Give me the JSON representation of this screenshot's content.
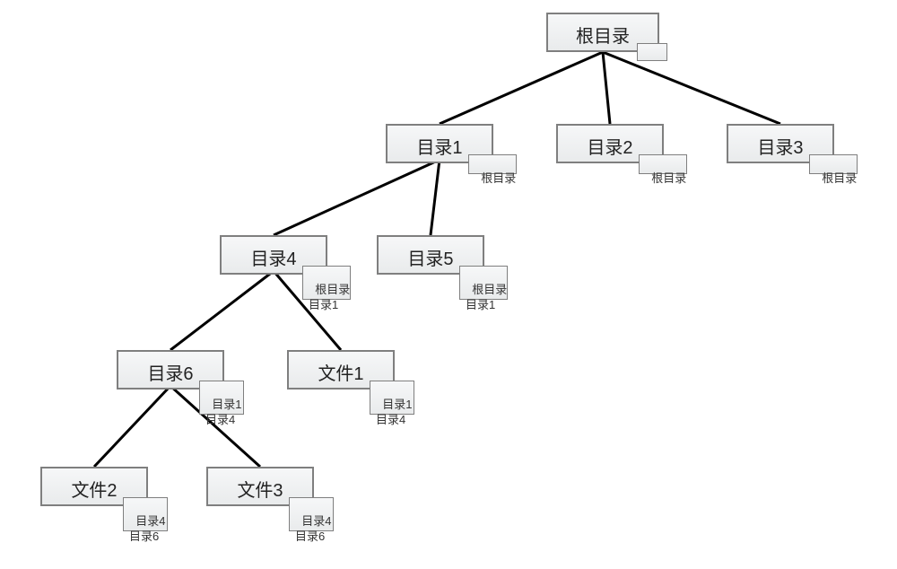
{
  "nodes": {
    "root": {
      "label": "根目录"
    },
    "dir1": {
      "label": "目录1",
      "pathlines": [
        "根目录"
      ]
    },
    "dir2": {
      "label": "目录2",
      "pathlines": [
        "根目录"
      ]
    },
    "dir3": {
      "label": "目录3",
      "pathlines": [
        "根目录"
      ]
    },
    "dir4": {
      "label": "目录4",
      "pathlines": [
        "根目录",
        "目录1"
      ]
    },
    "dir5": {
      "label": "目录5",
      "pathlines": [
        "根目录",
        "目录1"
      ]
    },
    "dir6": {
      "label": "目录6",
      "pathlines": [
        "目录1",
        "目录4"
      ]
    },
    "file1": {
      "label": "文件1",
      "pathlines": [
        "目录1",
        "目录4"
      ]
    },
    "file2": {
      "label": "文件2",
      "pathlines": [
        "目录4",
        "目录6"
      ]
    },
    "file3": {
      "label": "文件3",
      "pathlines": [
        "目录4",
        "目录6"
      ]
    }
  },
  "root_sub_blank": "",
  "chart_data": {
    "type": "tree",
    "title": "",
    "root": "根目录",
    "edges": [
      [
        "根目录",
        "目录1"
      ],
      [
        "根目录",
        "目录2"
      ],
      [
        "根目录",
        "目录3"
      ],
      [
        "目录1",
        "目录4"
      ],
      [
        "目录1",
        "目录5"
      ],
      [
        "目录4",
        "目录6"
      ],
      [
        "目录4",
        "文件1"
      ],
      [
        "目录6",
        "文件2"
      ],
      [
        "目录6",
        "文件3"
      ]
    ],
    "node_annotations": {
      "根目录": [],
      "目录1": [
        "根目录"
      ],
      "目录2": [
        "根目录"
      ],
      "目录3": [
        "根目录"
      ],
      "目录4": [
        "根目录",
        "目录1"
      ],
      "目录5": [
        "根目录",
        "目录1"
      ],
      "目录6": [
        "目录1",
        "目录4"
      ],
      "文件1": [
        "目录1",
        "目录4"
      ],
      "文件2": [
        "目录4",
        "目录6"
      ],
      "文件3": [
        "目录4",
        "目录6"
      ]
    }
  }
}
